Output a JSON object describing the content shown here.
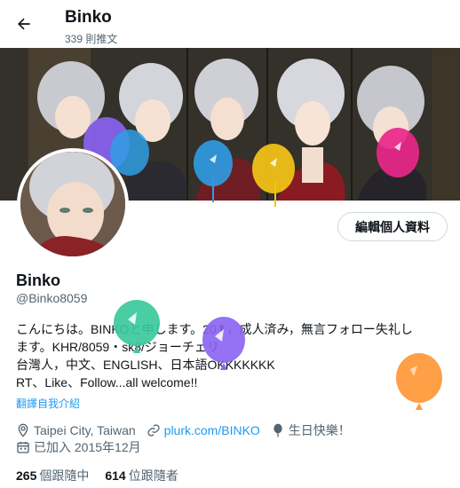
{
  "header": {
    "title": "Binko",
    "tweet_count": "339 則推文"
  },
  "banner": {
    "description": "banner-artwork"
  },
  "actions": {
    "edit_profile": "編輯個人資料"
  },
  "profile": {
    "name": "Binko",
    "handle": "@Binko8059",
    "bio": [
      "こんにちは。BINKOと申します。20⬆，成人済み，無言フォロー失礼し",
      "ます。KHR/8059・sk8/ジョーチェリ",
      "台灣人，中文、ENGLISH、日本語OKKKKKKK",
      "RT、Like、Follow...all welcome!!"
    ],
    "translate_label": "翻譯自我介紹",
    "location": "Taipei City, Taiwan",
    "website": "plurk.com/BINKO",
    "birthday": "生日快樂！",
    "joined": "已加入 2015年12月",
    "following_count": "265",
    "following_label": "個跟隨中",
    "followers_count": "614",
    "followers_label": "位跟隨者"
  },
  "colors": {
    "accent": "#1d9bf0",
    "secondary_text": "#536471",
    "primary_text": "#0f1419",
    "balloon_purple": "#8a63f2",
    "balloon_blue": "#2f9de4",
    "balloon_yellow": "#f5c517",
    "balloon_pink": "#e8278a",
    "balloon_green": "#3bc99a",
    "balloon_orange": "#ff9a3c"
  },
  "icons": {
    "back": "arrow-left-icon",
    "location": "location-pin-icon",
    "link": "link-icon",
    "birthday": "balloon-icon",
    "calendar": "calendar-icon"
  }
}
